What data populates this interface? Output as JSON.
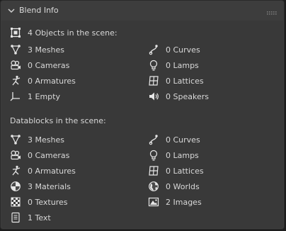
{
  "panel": {
    "title": "Blend Info"
  },
  "objects_section": {
    "heading": "4 Objects in the scene:",
    "left": [
      {
        "icon": "mesh-icon",
        "label": "3 Meshes"
      },
      {
        "icon": "camera-icon",
        "label": "0 Cameras"
      },
      {
        "icon": "armature-icon",
        "label": "0 Armatures"
      },
      {
        "icon": "empty-icon",
        "label": "1 Empty"
      }
    ],
    "right": [
      {
        "icon": "curve-icon",
        "label": "0 Curves"
      },
      {
        "icon": "lamp-icon",
        "label": "0 Lamps"
      },
      {
        "icon": "lattice-icon",
        "label": "0 Lattices"
      },
      {
        "icon": "speaker-icon",
        "label": "0 Speakers"
      }
    ]
  },
  "datablocks_section": {
    "heading": "Datablocks in the scene:",
    "left": [
      {
        "icon": "mesh-icon",
        "label": "3 Meshes"
      },
      {
        "icon": "camera-icon",
        "label": "0 Cameras"
      },
      {
        "icon": "armature-icon",
        "label": "0 Armatures"
      },
      {
        "icon": "material-icon",
        "label": "3 Materials"
      },
      {
        "icon": "texture-icon",
        "label": "0 Textures"
      },
      {
        "icon": "text-icon",
        "label": "1 Text"
      }
    ],
    "right": [
      {
        "icon": "curve-icon",
        "label": "0 Curves"
      },
      {
        "icon": "lamp-icon",
        "label": "0 Lamps"
      },
      {
        "icon": "lattice-icon",
        "label": "0 Lattices"
      },
      {
        "icon": "world-icon",
        "label": "0 Worlds"
      },
      {
        "icon": "image-icon",
        "label": "2 Images"
      }
    ]
  }
}
